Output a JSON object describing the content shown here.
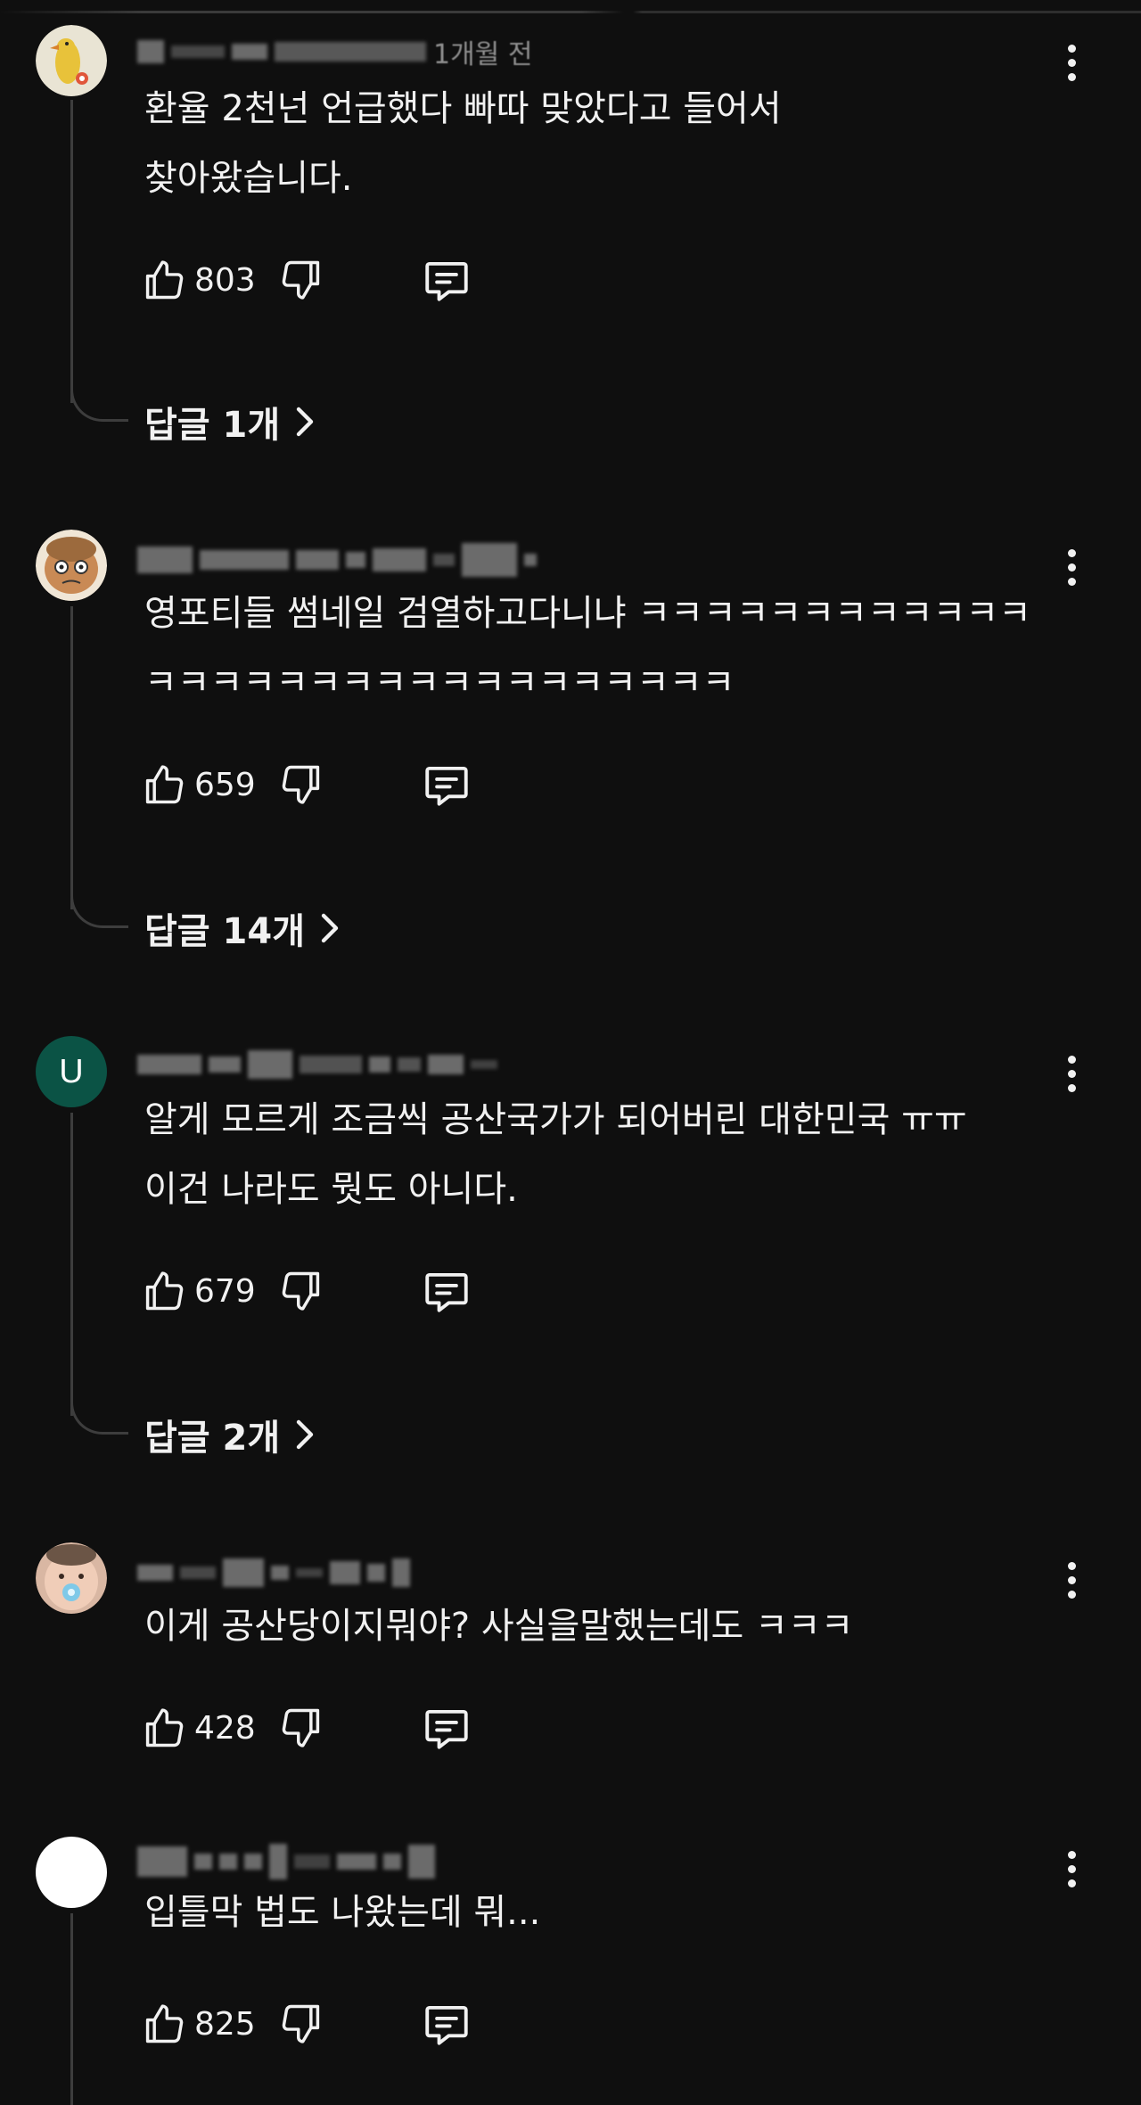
{
  "comments": [
    {
      "author_meta": "1개월 전",
      "text": "환율 2천넌 언급했다 빠따 맞았다고 들어서\n찾아왔습니다.",
      "likes": "803",
      "replies_label": "답글 1개",
      "avatar": "yellow-bird-avatar"
    },
    {
      "author_meta": "",
      "text": "영포티들 썸네일 검열하고다니냐 ㅋㅋㅋㅋㅋㅋㅋㅋㅋㅋㅋㅋ\nㅋㅋㅋㅋㅋㅋㅋㅋㅋㅋㅋㅋㅋㅋㅋㅋㅋㅋ",
      "likes": "659",
      "replies_label": "답글 14개",
      "avatar": "cartoon-face-avatar"
    },
    {
      "author_meta": "",
      "text": "알게 모르게 조금씩 공산국가가 되어버린 대한민국 ㅠㅠ\n이건 나라도 뭣도 아니다.",
      "likes": "679",
      "replies_label": "답글 2개",
      "avatar_letter": "U",
      "avatar_color": "#0b5345"
    },
    {
      "author_meta": "",
      "text": "이게 공산당이지뭐야? 사실을말했는데도 ㅋㅋㅋ",
      "likes": "428",
      "avatar": "baby-photo-avatar"
    },
    {
      "author_meta": "",
      "text": "입틀막 법도 나왔는데 뭐...",
      "likes": "825",
      "avatar": "white-circle-avatar"
    }
  ],
  "icons": {
    "like": "thumbs-up-icon",
    "dislike": "thumbs-down-icon",
    "reply": "reply-icon",
    "more": "more-vert-icon",
    "chevron": "chevron-right-icon"
  },
  "colors": {
    "background": "#0f0f0f",
    "text": "#f1f1f1",
    "muted": "#8e8e8e",
    "thread_line": "#3d3d3d"
  }
}
